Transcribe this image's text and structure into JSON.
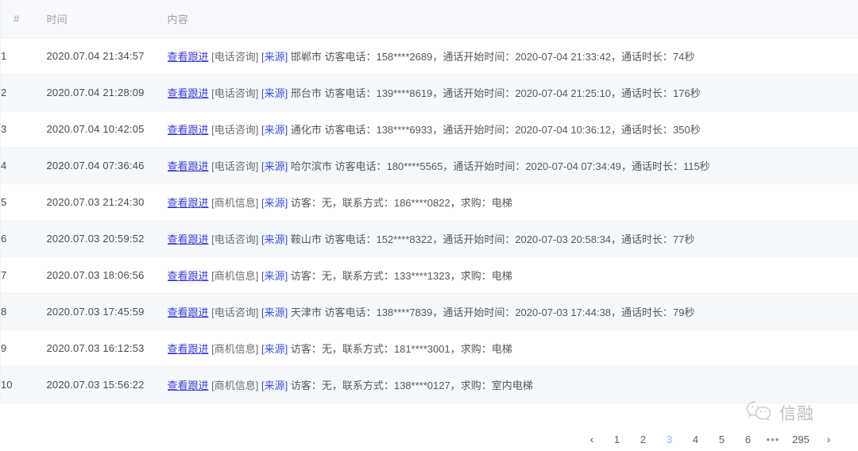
{
  "table": {
    "columns": [
      {
        "key": "index",
        "label": "#"
      },
      {
        "key": "time",
        "label": "时间"
      },
      {
        "key": "content",
        "label": "内容"
      }
    ],
    "rows": [
      {
        "index": "1",
        "time": "2020.07.04 21:34:57",
        "link_label": "查看跟进",
        "type_tag": "[电话咨询]",
        "source_tag": "[来源]",
        "detail": "邯郸市 访客电话：158****2689，通话开始时间：2020-07-04 21:33:42，通话时长：74秒"
      },
      {
        "index": "2",
        "time": "2020.07.04 21:28:09",
        "link_label": "查看跟进",
        "type_tag": "[电话咨询]",
        "source_tag": "[来源]",
        "detail": "邢台市 访客电话：139****8619，通话开始时间：2020-07-04 21:25:10，通话时长：176秒"
      },
      {
        "index": "3",
        "time": "2020.07.04 10:42:05",
        "link_label": "查看跟进",
        "type_tag": "[电话咨询]",
        "source_tag": "[来源]",
        "detail": "通化市 访客电话：138****6933，通话开始时间：2020-07-04 10:36:12，通话时长：350秒"
      },
      {
        "index": "4",
        "time": "2020.07.04 07:36:46",
        "link_label": "查看跟进",
        "type_tag": "[电话咨询]",
        "source_tag": "[来源]",
        "detail": "哈尔滨市 访客电话：180****5565，通话开始时间：2020-07-04 07:34:49，通话时长：115秒"
      },
      {
        "index": "5",
        "time": "2020.07.03 21:24:30",
        "link_label": "查看跟进",
        "type_tag": "[商机信息]",
        "source_tag": "[来源]",
        "detail": "访客：无，联系方式：186****0822，求购：电梯"
      },
      {
        "index": "6",
        "time": "2020.07.03 20:59:52",
        "link_label": "查看跟进",
        "type_tag": "[电话咨询]",
        "source_tag": "[来源]",
        "detail": "鞍山市 访客电话：152****8322，通话开始时间：2020-07-03 20:58:34，通话时长：77秒"
      },
      {
        "index": "7",
        "time": "2020.07.03 18:06:56",
        "link_label": "查看跟进",
        "type_tag": "[商机信息]",
        "source_tag": "[来源]",
        "detail": "访客：无，联系方式：133****1323，求购：电梯"
      },
      {
        "index": "8",
        "time": "2020.07.03 17:45:59",
        "link_label": "查看跟进",
        "type_tag": "[电话咨询]",
        "source_tag": "[来源]",
        "detail": "天津市 访客电话：138****7839，通话开始时间：2020-07-03 17:44:38，通话时长：79秒"
      },
      {
        "index": "9",
        "time": "2020.07.03 16:12:53",
        "link_label": "查看跟进",
        "type_tag": "[商机信息]",
        "source_tag": "[来源]",
        "detail": "访客：无，联系方式：181****3001，求购：电梯"
      },
      {
        "index": "10",
        "time": "2020.07.03 15:56:22",
        "link_label": "查看跟进",
        "type_tag": "[商机信息]",
        "source_tag": "[来源]",
        "detail": "访客：无，联系方式：138****0127，求购：室内电梯"
      }
    ]
  },
  "pagination": {
    "prev_label": "‹",
    "next_label": "›",
    "ellipsis_label": "•••",
    "active_page": "3",
    "pages": [
      "1",
      "2",
      "3",
      "4",
      "5",
      "6"
    ],
    "last_page": "295"
  },
  "watermark": {
    "icon": "wechat-icon",
    "text": "信融"
  },
  "colors": {
    "link": "#3b3bdc",
    "source_tag": "#3b4fe0",
    "active_page": "#8fbaf6",
    "header_bg": "#f7f9fc",
    "stripe_bg": "#f6f9fc"
  }
}
